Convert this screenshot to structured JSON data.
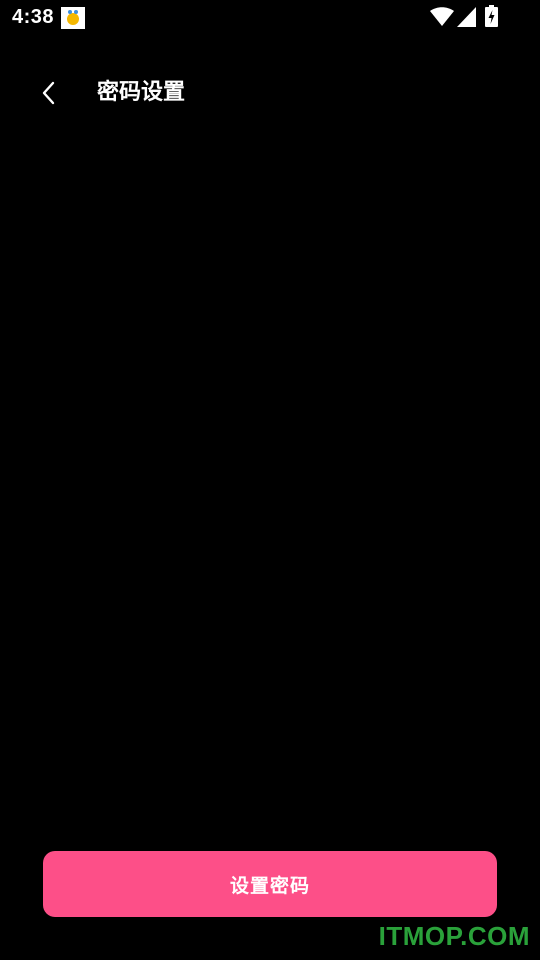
{
  "status_bar": {
    "time": "4:38",
    "icons": [
      "notification-app-icon",
      "wifi-icon",
      "signal-icon",
      "battery-charging-icon"
    ]
  },
  "header": {
    "back_icon": "chevron-left-icon",
    "title": "密码设置"
  },
  "actions": {
    "set_password_label": "设置密码"
  },
  "watermark": {
    "text": "ITMOP.COM"
  },
  "colors": {
    "background": "#000000",
    "accent": "#fd4f88",
    "text": "#ffffff",
    "watermark": "#2aa13a"
  }
}
